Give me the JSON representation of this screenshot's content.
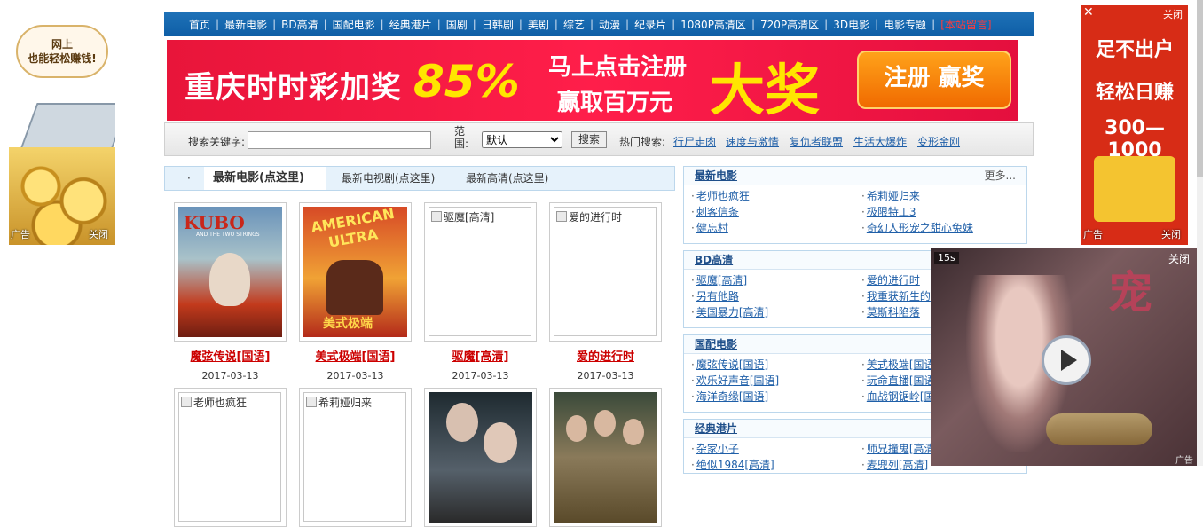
{
  "nav": {
    "items": [
      "首页",
      "最新电影",
      "BD高清",
      "国配电影",
      "经典港片",
      "国剧",
      "日韩剧",
      "美剧",
      "综艺",
      "动漫",
      "纪录片",
      "1080P高清区",
      "720P高清区",
      "3D电影",
      "电影专题",
      "[本站留言]"
    ]
  },
  "banner": {
    "left_text": "重庆时时彩加奖",
    "percent": "85%",
    "middle_top": "马上点击注册",
    "middle_bottom": "赢取百万元",
    "big": "大奖",
    "button": "注册 赢奖"
  },
  "ad_left": {
    "line1": "网上",
    "line2": "也能轻松赚钱!",
    "ad_label": "广告",
    "close_label": "关闭"
  },
  "ad_right": {
    "close_x": "✕",
    "close_label": "关闭",
    "line1": "足不出户",
    "line2": "轻松日赚",
    "line3": "300—1000",
    "ad_label": "广告",
    "close_bottom": "关闭"
  },
  "search": {
    "keyword_label": "搜索关键字:",
    "keyword_value": "",
    "scope_label": "范围:",
    "scope_selected": "默认",
    "button": "搜索",
    "hot_label": "热门搜索:",
    "hot": [
      "行尸走肉",
      "速度与激情",
      "复仇者联盟",
      "生活大爆炸",
      "变形金刚"
    ]
  },
  "tabs": {
    "items": [
      "最新电影(点这里)",
      "最新电视剧(点这里)",
      "最新高清(点这里)"
    ]
  },
  "movies": [
    {
      "title": "魔弦传说[国语]",
      "date": "2017-03-13",
      "alt": ""
    },
    {
      "title": "美式极端[国语]",
      "date": "2017-03-13",
      "alt": ""
    },
    {
      "title": "驱魔[高清]",
      "date": "2017-03-13",
      "alt": "驱魔[高清]"
    },
    {
      "title": "爱的进行时",
      "date": "2017-03-13",
      "alt": "爱的进行时"
    },
    {
      "title": "",
      "date": "",
      "alt": "老师也疯狂"
    },
    {
      "title": "",
      "date": "",
      "alt": "希莉娅归来"
    },
    {
      "title": "",
      "date": "",
      "alt": ""
    },
    {
      "title": "",
      "date": "",
      "alt": ""
    }
  ],
  "poster_text": {
    "kubo_title": "KUBO",
    "kubo_sub": "AND THE TWO STRINGS",
    "american_title": "AMERICAN",
    "american_title2": "ULTRA",
    "american_cn": "美式极端"
  },
  "boxes": [
    {
      "title": "最新电影",
      "more": "更多...",
      "items": [
        "老师也疯狂",
        "希莉娅归来",
        "刺客信条",
        "极限特工3",
        "健忘村",
        "奇幻人形宠之甜心兔妹"
      ]
    },
    {
      "title": "BD高清",
      "more": "",
      "items": [
        "驱魔[高清]",
        "爱的进行时",
        "另有他路",
        "我重获新生的",
        "美国暴力[高清]",
        "莫斯科陷落"
      ]
    },
    {
      "title": "国配电影",
      "more": "",
      "items": [
        "魔弦传说[国语]",
        "美式极端[国语]",
        "欢乐好声音[国语]",
        "玩命直播[国语]",
        "海洋奇缘[国语]",
        "血战钢锯岭[国语]"
      ]
    },
    {
      "title": "经典港片",
      "more": "",
      "items": [
        "杂家小子",
        "师兄撞鬼[高清]",
        "绝似1984[高清]",
        "麦兜列[高清]"
      ]
    }
  ],
  "bullet": "·",
  "video_ad": {
    "timer": "15s",
    "close": "关闭",
    "ad_label": "广告"
  }
}
